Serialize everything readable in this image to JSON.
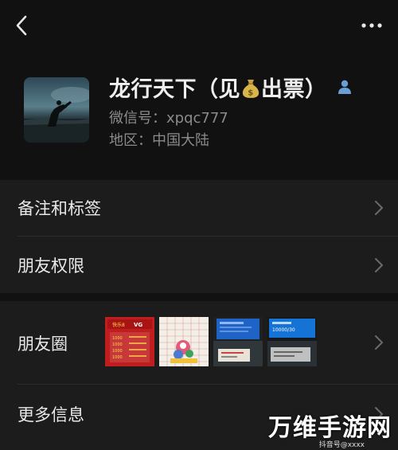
{
  "header": {
    "back_icon": "chevron-left-icon",
    "more_icon": "more-dots-icon"
  },
  "profile": {
    "name_before": "龙行天下（见",
    "name_after": "出票）",
    "name_emoji": "money-bag-icon",
    "badge_icon": "contact-person-icon",
    "wechat_id": "微信号：xpqc777",
    "region": "地区：中国大陆"
  },
  "menu": {
    "remarks_label": "备注和标签",
    "permissions_label": "朋友权限",
    "moments_label": "朋友圈",
    "more_info_label": "更多信息"
  },
  "moments": {
    "thumb1": {
      "lines": [
        "快乐8",
        "VG",
        "1000",
        "1000",
        "1000",
        "1000"
      ]
    },
    "thumb4": {
      "line": "10000/30"
    }
  },
  "watermark": {
    "text": "万维手游网",
    "sub": "抖音号@xxxx"
  },
  "colors": {
    "background": "#111111",
    "section": "#1c1c1c",
    "text_primary": "#e8e8e8",
    "text_secondary": "#8b8b8b",
    "badge": "#6a9fd4"
  }
}
